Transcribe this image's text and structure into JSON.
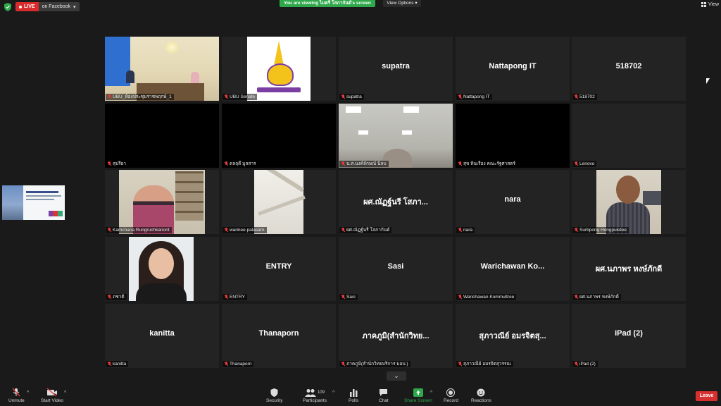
{
  "topbar": {
    "live_label": "LIVE",
    "stream_target": "on Facebook",
    "viewing_banner": "You are viewing ไมตรี โสภากันต์'s screen",
    "view_options": "View Options",
    "view_button": "View"
  },
  "colors": {
    "live_red": "#d92b2b",
    "viewing_green": "#2ea84a",
    "active_speaker_border": "#c6e24a",
    "muted_mic": "#e23b3b",
    "leave_red": "#d73030"
  },
  "participants": [
    {
      "name": "UBU_ห้องประชุมราชพฤกษ์_1",
      "big": ""
    },
    {
      "name": "UBU Senate",
      "big": ""
    },
    {
      "name": "supatra",
      "big": "supatra"
    },
    {
      "name": "Nattapong IT",
      "big": "Nattapong IT"
    },
    {
      "name": "518702",
      "big": "518702"
    },
    {
      "name": "สุปรียา",
      "big": ""
    },
    {
      "name": "ดลฤดี มูลสาร",
      "big": ""
    },
    {
      "name": "น.ส.นงค์ลักษณ์ นิลบ",
      "big": ""
    },
    {
      "name": "สุข ทินเรือง คณะรัฐศาสตร์",
      "big": ""
    },
    {
      "name": "Lenovo",
      "big": ""
    },
    {
      "name": "Kamchana Rungruchkanont",
      "big": ""
    },
    {
      "name": "warinee palasarn",
      "big": ""
    },
    {
      "name": "ผศ.ณัฏฐ์นรี โสภากันต์",
      "big": "ผศ.ณัฏฐ์นรี โสภา..."
    },
    {
      "name": "nara",
      "big": "nara"
    },
    {
      "name": "Surbpong Hongpukdee",
      "big": ""
    },
    {
      "name": "ภชาติ",
      "big": ""
    },
    {
      "name": "ENTRY",
      "big": "ENTRY"
    },
    {
      "name": "Sasi",
      "big": "Sasi"
    },
    {
      "name": "Warichawan Kommultree",
      "big": "Warichawan Ko..."
    },
    {
      "name": "ผศ.นภาพร หงษ์ภักดี",
      "big": "ผศ.นภาพร หงษ์ภักดี"
    },
    {
      "name": "kanitta",
      "big": "kanitta"
    },
    {
      "name": "Thanaporn",
      "big": "Thanaporn"
    },
    {
      "name": "ภาคภูมิ(สำนักวิทยบริการ มอบ.)",
      "big": "ภาคภูมิ(สำนักวิทย..."
    },
    {
      "name": "สุภาวณีย์ อมรจิตสุวรรณ",
      "big": "สุภาวณีย์ อมรจิตสุ..."
    },
    {
      "name": "iPad (2)",
      "big": "iPad (2)"
    }
  ],
  "toolbar": {
    "unmute": "Unmute",
    "start_video": "Start Video",
    "security": "Security",
    "participants": "Participants",
    "participant_count": "109",
    "polls": "Polls",
    "chat": "Chat",
    "share_screen": "Share Screen",
    "record": "Record",
    "reactions": "Reactions",
    "leave": "Leave"
  },
  "icons": [
    "shield-icon",
    "live-dot-icon",
    "dropdown-caret-icon",
    "grid-view-icon",
    "mic-muted-icon",
    "video-off-icon",
    "security-shield-icon",
    "participants-icon",
    "polls-icon",
    "chat-icon",
    "share-screen-icon",
    "record-icon",
    "reactions-icon",
    "chevron-down-icon"
  ]
}
